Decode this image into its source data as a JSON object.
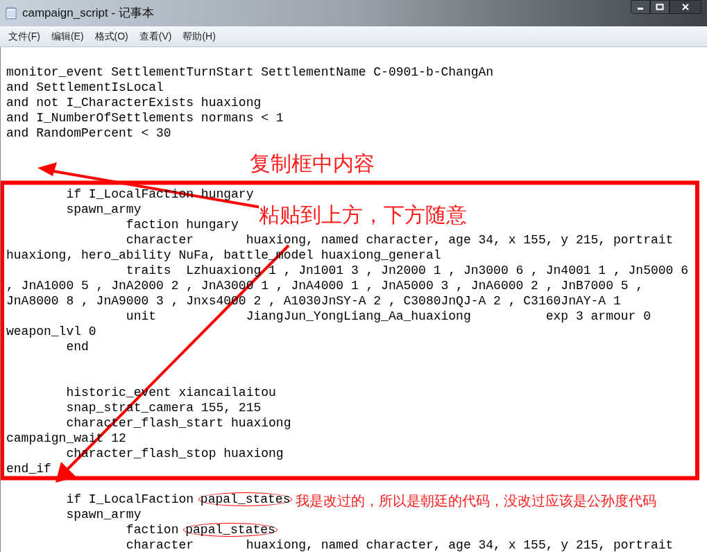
{
  "window": {
    "title": "campaign_script - 记事本"
  },
  "menu": [
    "文件(F)",
    "编辑(E)",
    "格式(O)",
    "查看(V)",
    "帮助(H)"
  ],
  "lines": [
    {
      "kind": "code",
      "text": "monitor_event SettlementTurnStart SettlementName C-0901-b-ChangAn"
    },
    {
      "kind": "code",
      "text": "and SettlementIsLocal"
    },
    {
      "kind": "code",
      "text": "and not I_CharacterExists huaxiong"
    },
    {
      "kind": "code",
      "text": "and I_NumberOfSettlements normans < 1"
    },
    {
      "kind": "code",
      "text": "and RandomPercent < 30"
    },
    {
      "kind": "blank"
    },
    {
      "kind": "blank"
    },
    {
      "kind": "blank"
    },
    {
      "kind": "code",
      "text": "        if I_LocalFaction hungary"
    },
    {
      "kind": "code",
      "text": "        spawn_army"
    },
    {
      "kind": "code",
      "text": "                faction hungary"
    },
    {
      "kind": "code",
      "text": "                character       huaxiong, named character, age 34, x 155, y 215, portrait"
    },
    {
      "kind": "code",
      "text": "huaxiong, hero_ability NuFa, battle_model huaxiong_general"
    },
    {
      "kind": "code",
      "text": "                traits  Lzhuaxiong 1 , Jn1001 3 , Jn2000 1 , Jn3000 6 , Jn4001 1 , Jn5000 6"
    },
    {
      "kind": "code",
      "text": ", JnA1000 5 , JnA2000 2 , JnA3000 1 , JnA4000 1 , JnA5000 3 , JnA6000 2 , JnB7000 5 ,"
    },
    {
      "kind": "code",
      "text": "JnA8000 8 , JnA9000 3 , Jnxs4000 2 , A1030JnSY-A 2 , C3080JnQJ-A 2 , C3160JnAY-A 1"
    },
    {
      "kind": "code",
      "text": "                unit            JiangJun_YongLiang_Aa_huaxiong          exp 3 armour 0"
    },
    {
      "kind": "code",
      "text": "weapon_lvl 0"
    },
    {
      "kind": "code",
      "text": "        end"
    },
    {
      "kind": "blank"
    },
    {
      "kind": "blank"
    },
    {
      "kind": "code",
      "text": "        historic_event xiancailaitou"
    },
    {
      "kind": "code",
      "text": "        snap_strat_camera 155, 215"
    },
    {
      "kind": "code",
      "text": "        character_flash_start huaxiong"
    },
    {
      "kind": "code",
      "text": "campaign_wait 12"
    },
    {
      "kind": "code",
      "text": "        character_flash_stop huaxiong"
    },
    {
      "kind": "code",
      "text": "end_if"
    },
    {
      "kind": "blank"
    },
    {
      "kind": "code",
      "text": "        if I_LocalFaction",
      "circled": "papal_states"
    },
    {
      "kind": "code",
      "text": "        spawn_army"
    },
    {
      "kind": "code",
      "text": "                faction",
      "circled": "papal_states"
    },
    {
      "kind": "code",
      "text": "                character       huaxiong, named character, age 34, x 155, y 215, portrait"
    }
  ],
  "annotations": [
    {
      "kind": "caption",
      "text": "复制框中内容"
    },
    {
      "kind": "caption",
      "text": "粘贴到上方，下方随意"
    },
    {
      "kind": "note",
      "text": "我是改过的，所以是朝廷的代码，没改过应该是公孙度代码"
    }
  ]
}
